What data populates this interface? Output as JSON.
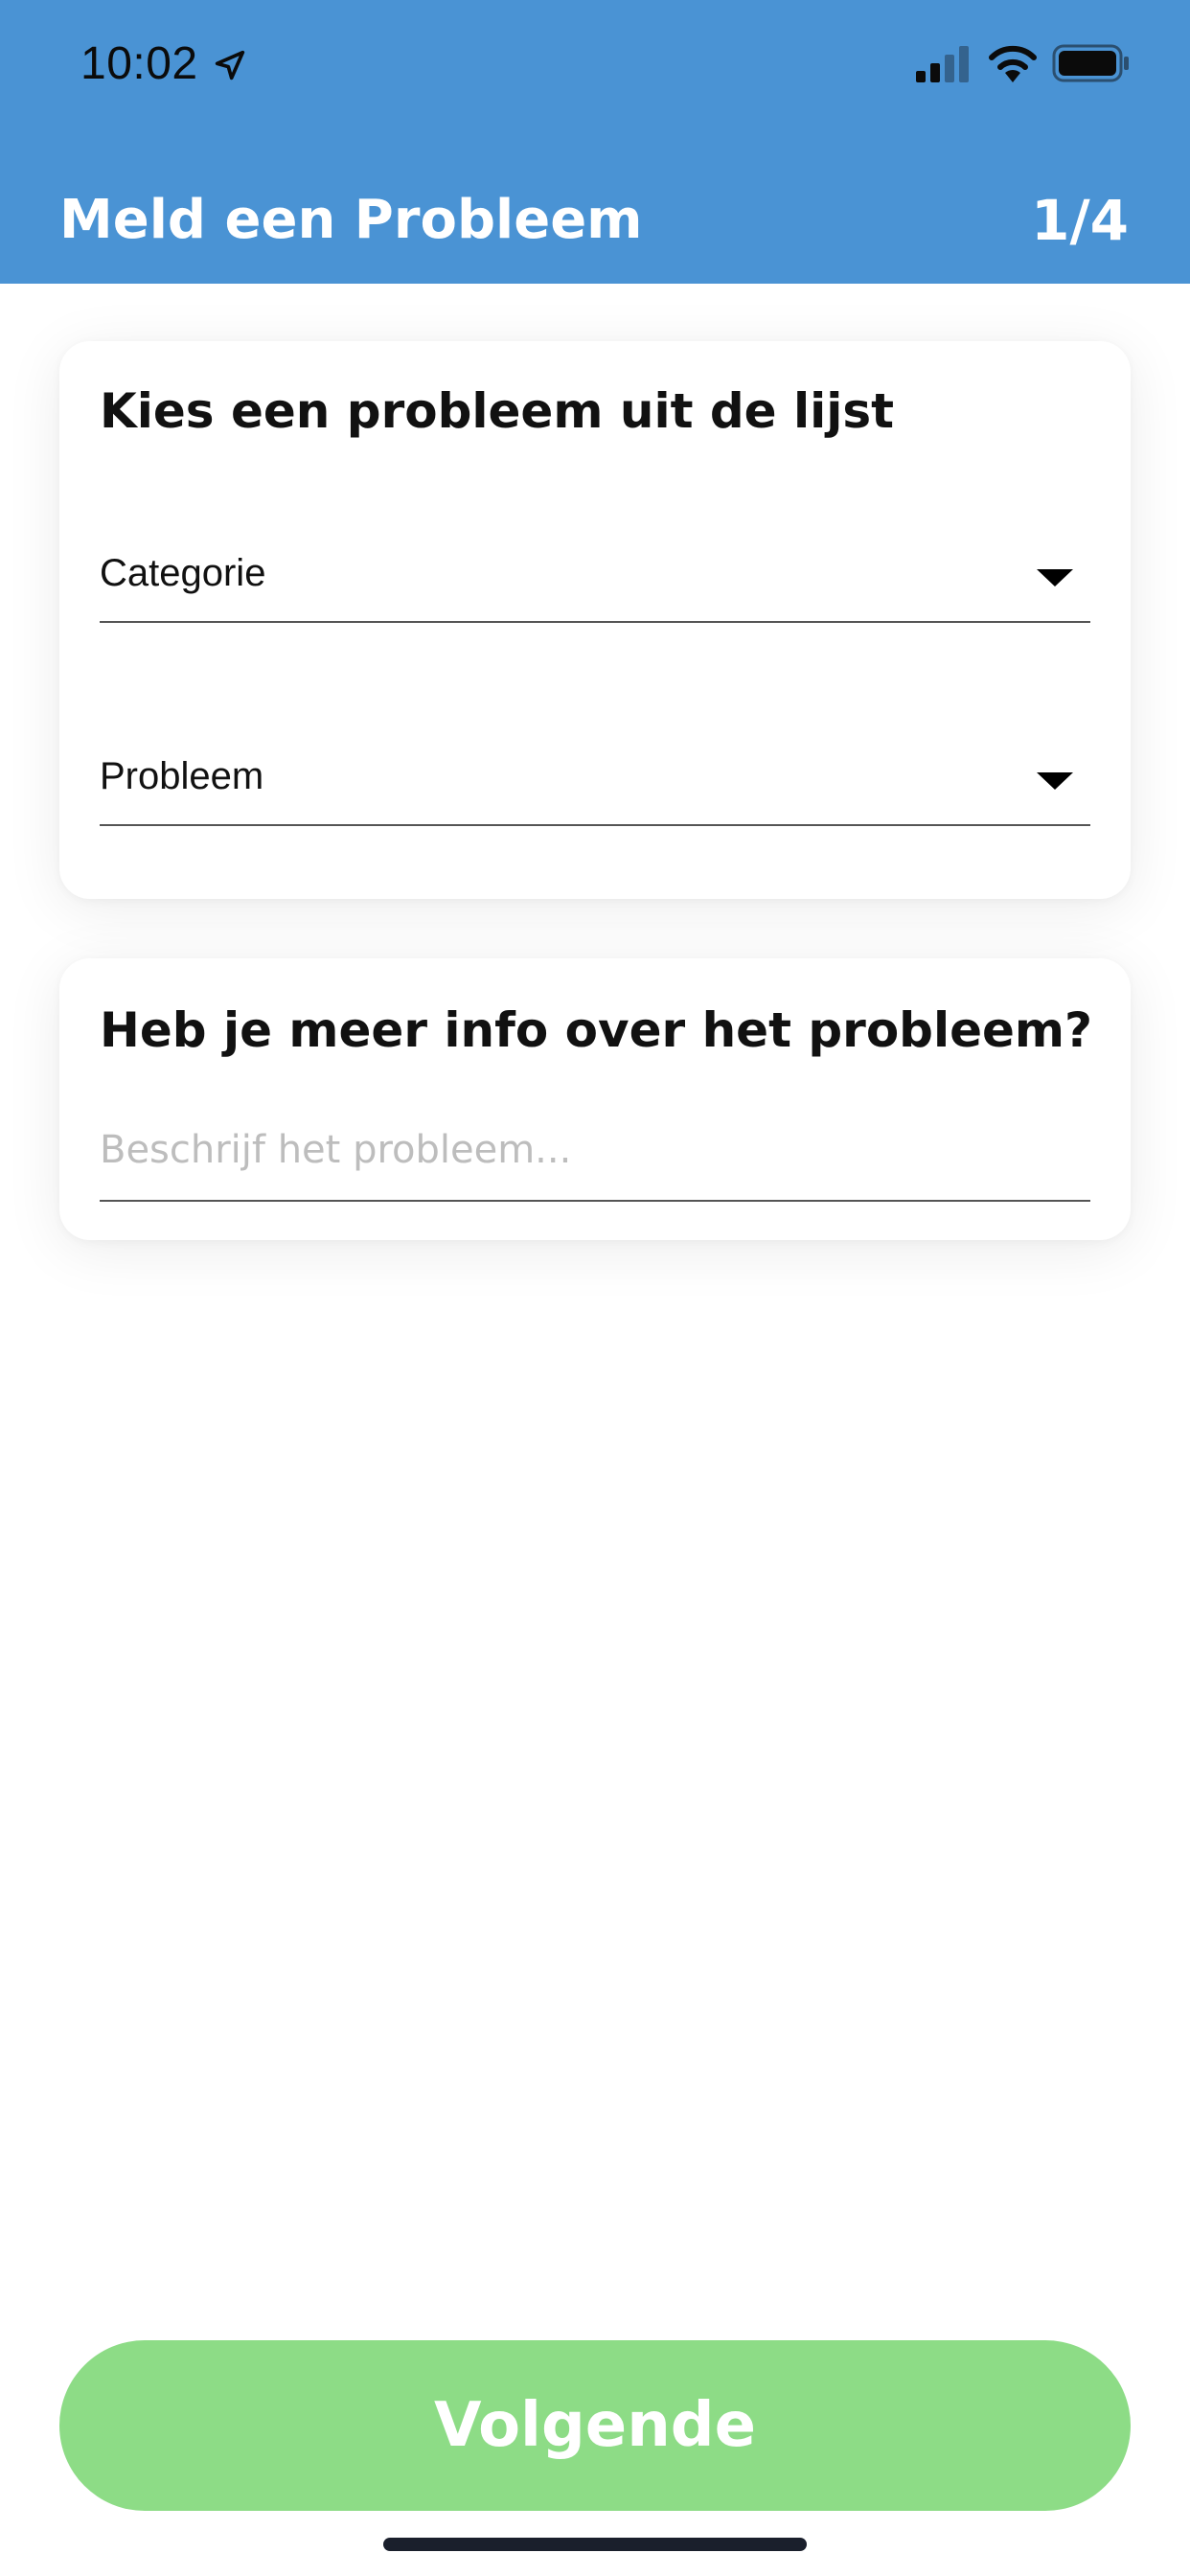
{
  "status_bar": {
    "time": "10:02",
    "icons": [
      "location-arrow-icon",
      "cellular-signal-icon",
      "wifi-icon",
      "battery-icon"
    ]
  },
  "header": {
    "title": "Meld een Probleem",
    "step": "1/4",
    "background_color": "#4a93d4"
  },
  "card_problem": {
    "title": "Kies een probleem uit de lijst",
    "category_dropdown": {
      "label": "Categorie"
    },
    "problem_dropdown": {
      "label": "Probleem"
    }
  },
  "card_info": {
    "title": "Heb je meer info over het probleem?",
    "description": {
      "value": "",
      "placeholder": "Beschrijf het probleem..."
    }
  },
  "footer": {
    "next_label": "Volgende",
    "button_color": "#8ddc86"
  }
}
